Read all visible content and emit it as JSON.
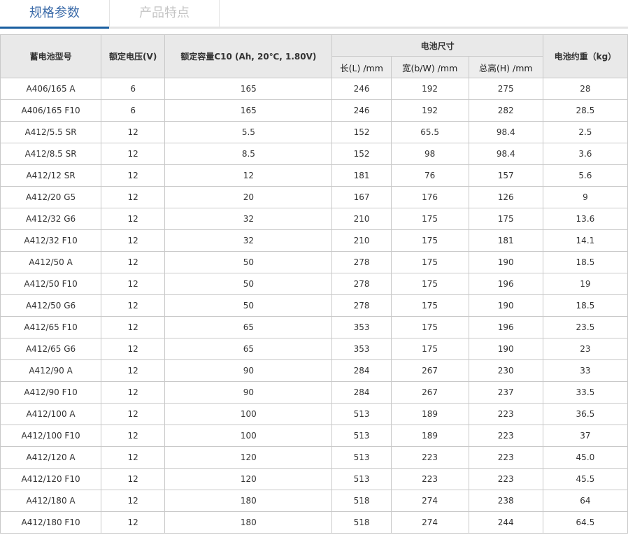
{
  "tabs": [
    {
      "label": "规格参数",
      "active": true
    },
    {
      "label": "产品特点",
      "active": false
    }
  ],
  "colors": {
    "accent": "#1a5fa0",
    "active_tab_text": "#3a6aa8",
    "inactive_tab_text": "#c4c4c4",
    "header_bg": "#e9e9e9",
    "border": "#c9c9c9"
  },
  "table": {
    "headers": {
      "model": "蓄电池型号",
      "voltage": "额定电压(V)",
      "capacity": "额定容量C10 (Ah, 20℃, 1.80V)",
      "dimensions": "电池尺寸",
      "length": "长(L) /mm",
      "width": "宽(b/W) /mm",
      "height": "总高(H) /mm",
      "weight": "电池约重（kg）"
    },
    "rows": [
      [
        "A406/165 A",
        "6",
        "165",
        "246",
        "192",
        "275",
        "28"
      ],
      [
        "A406/165 F10",
        "6",
        "165",
        "246",
        "192",
        "282",
        "28.5"
      ],
      [
        "A412/5.5 SR",
        "12",
        "5.5",
        "152",
        "65.5",
        "98.4",
        "2.5"
      ],
      [
        "A412/8.5 SR",
        "12",
        "8.5",
        "152",
        "98",
        "98.4",
        "3.6"
      ],
      [
        "A412/12 SR",
        "12",
        "12",
        "181",
        "76",
        "157",
        "5.6"
      ],
      [
        "A412/20 G5",
        "12",
        "20",
        "167",
        "176",
        "126",
        "9"
      ],
      [
        "A412/32 G6",
        "12",
        "32",
        "210",
        "175",
        "175",
        "13.6"
      ],
      [
        "A412/32 F10",
        "12",
        "32",
        "210",
        "175",
        "181",
        "14.1"
      ],
      [
        "A412/50 A",
        "12",
        "50",
        "278",
        "175",
        "190",
        "18.5"
      ],
      [
        "A412/50 F10",
        "12",
        "50",
        "278",
        "175",
        "196",
        "19"
      ],
      [
        "A412/50 G6",
        "12",
        "50",
        "278",
        "175",
        "190",
        "18.5"
      ],
      [
        "A412/65 F10",
        "12",
        "65",
        "353",
        "175",
        "196",
        "23.5"
      ],
      [
        "A412/65 G6",
        "12",
        "65",
        "353",
        "175",
        "190",
        "23"
      ],
      [
        "A412/90 A",
        "12",
        "90",
        "284",
        "267",
        "230",
        "33"
      ],
      [
        "A412/90 F10",
        "12",
        "90",
        "284",
        "267",
        "237",
        "33.5"
      ],
      [
        "A412/100 A",
        "12",
        "100",
        "513",
        "189",
        "223",
        "36.5"
      ],
      [
        "A412/100 F10",
        "12",
        "100",
        "513",
        "189",
        "223",
        "37"
      ],
      [
        "A412/120 A",
        "12",
        "120",
        "513",
        "223",
        "223",
        "45.0"
      ],
      [
        "A412/120 F10",
        "12",
        "120",
        "513",
        "223",
        "223",
        "45.5"
      ],
      [
        "A412/180 A",
        "12",
        "180",
        "518",
        "274",
        "238",
        "64"
      ],
      [
        "A412/180 F10",
        "12",
        "180",
        "518",
        "274",
        "244",
        "64.5"
      ]
    ]
  }
}
